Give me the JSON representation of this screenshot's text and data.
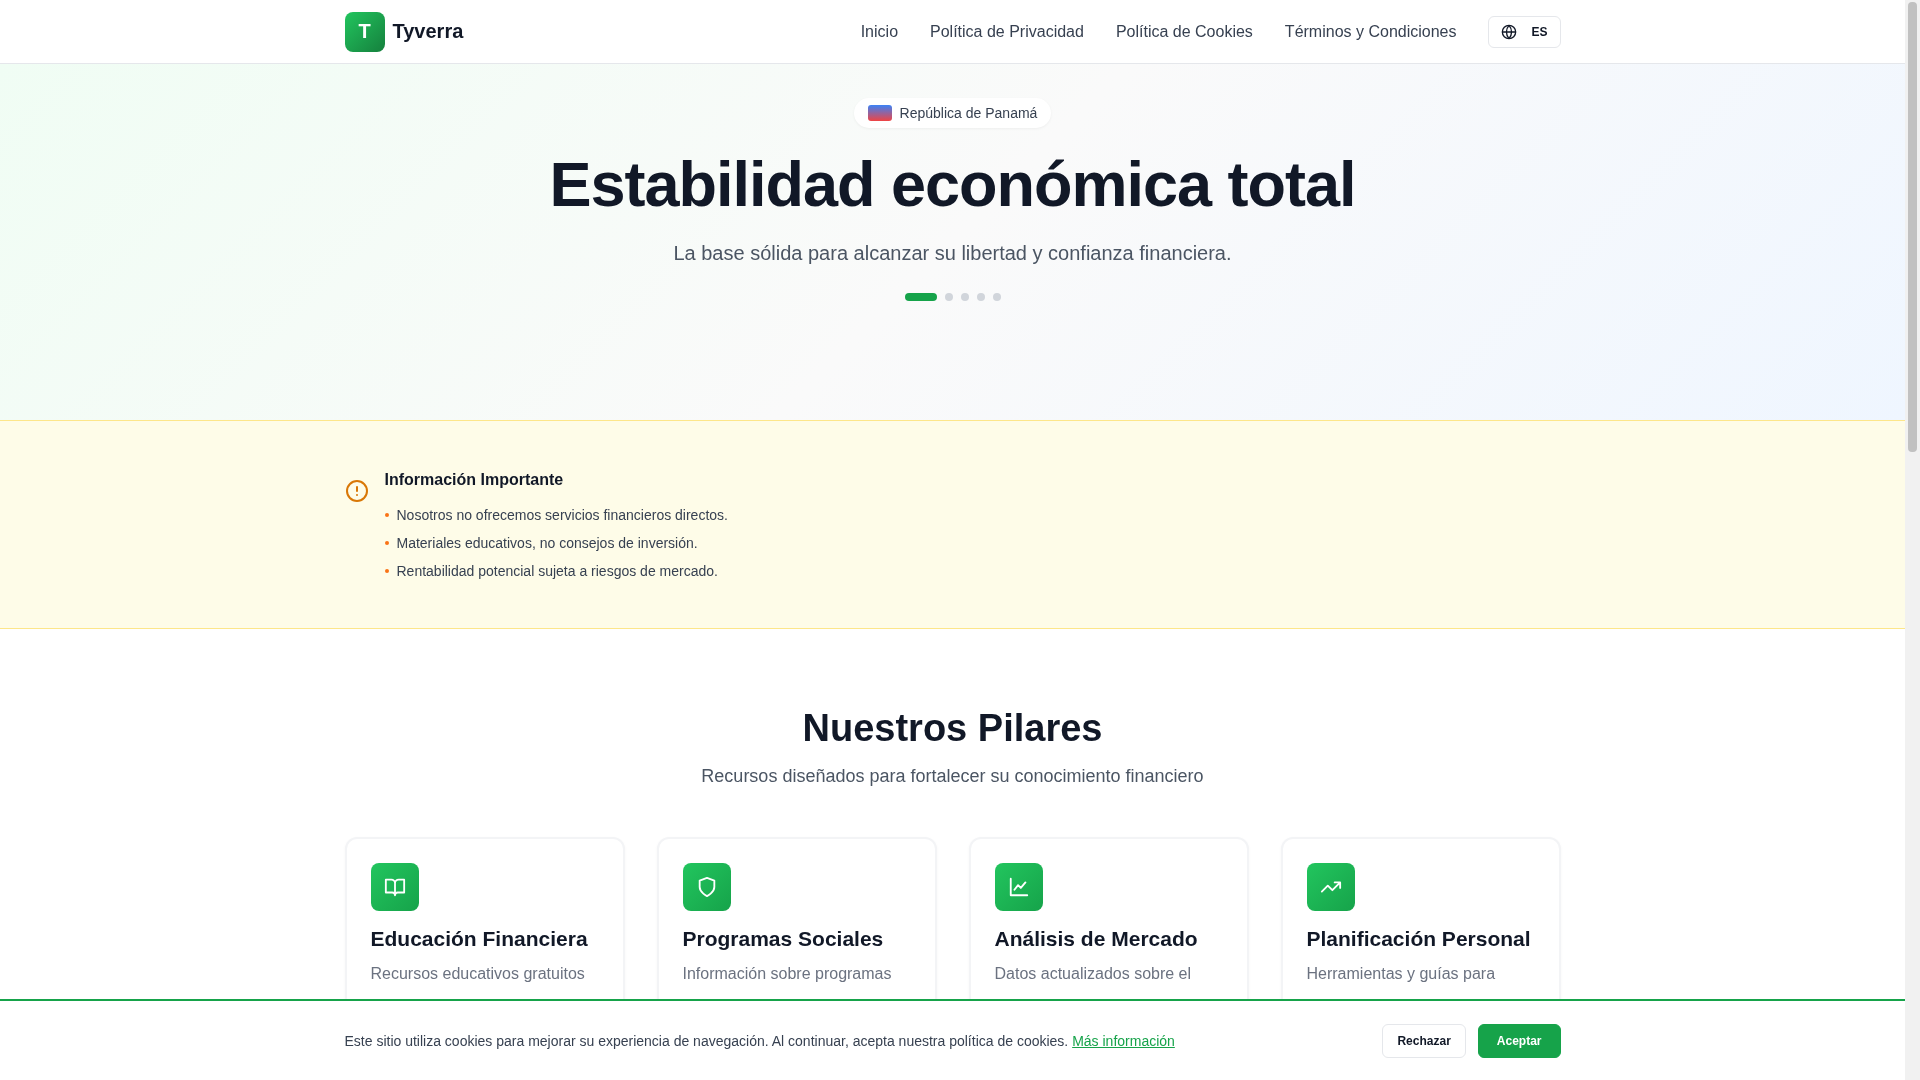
{
  "header": {
    "logo_letter": "T",
    "brand": "Tyverra",
    "nav": [
      {
        "label": "Inicio"
      },
      {
        "label": "Política de Privacidad"
      },
      {
        "label": "Política de Cookies"
      },
      {
        "label": "Términos y Condiciones"
      }
    ],
    "language": "ES"
  },
  "hero": {
    "badge": "República de Panamá",
    "title": "Estabilidad económica total",
    "subtitle": "La base sólida para alcanzar su libertad y confianza financiera.",
    "slides": [
      {
        "selected": true
      },
      {
        "selected": false
      },
      {
        "selected": false
      },
      {
        "selected": false
      },
      {
        "selected": false
      }
    ]
  },
  "notice": {
    "title": "Información Importante",
    "items": [
      "Nosotros no ofrecemos servicios financieros directos.",
      "Materiales educativos, no consejos de inversión.",
      "Rentabilidad potencial sujeta a riesgos de mercado."
    ]
  },
  "pillars": {
    "title": "Nuestros Pilares",
    "subtitle": "Recursos diseñados para fortalecer su conocimiento financiero",
    "cards": [
      {
        "kind": "book",
        "title": "Educación Financiera",
        "text": "Recursos educativos gratuitos"
      },
      {
        "kind": "shield",
        "title": "Programas Sociales",
        "text": "Información sobre programas"
      },
      {
        "kind": "chart",
        "title": "Análisis de Mercado",
        "text": "Datos actualizados sobre el"
      },
      {
        "kind": "trend",
        "title": "Planificación Personal",
        "text": "Herramientas y guías para"
      }
    ]
  },
  "cookie_bar": {
    "text": "Este sitio utiliza cookies para mejorar su experiencia de navegación. Al continuar, acepta nuestra política de cookies.",
    "link": "Más información",
    "buttons": [
      {
        "kind": "secondary",
        "label": "Rechazar"
      },
      {
        "kind": "primary",
        "label": "Aceptar"
      }
    ]
  }
}
